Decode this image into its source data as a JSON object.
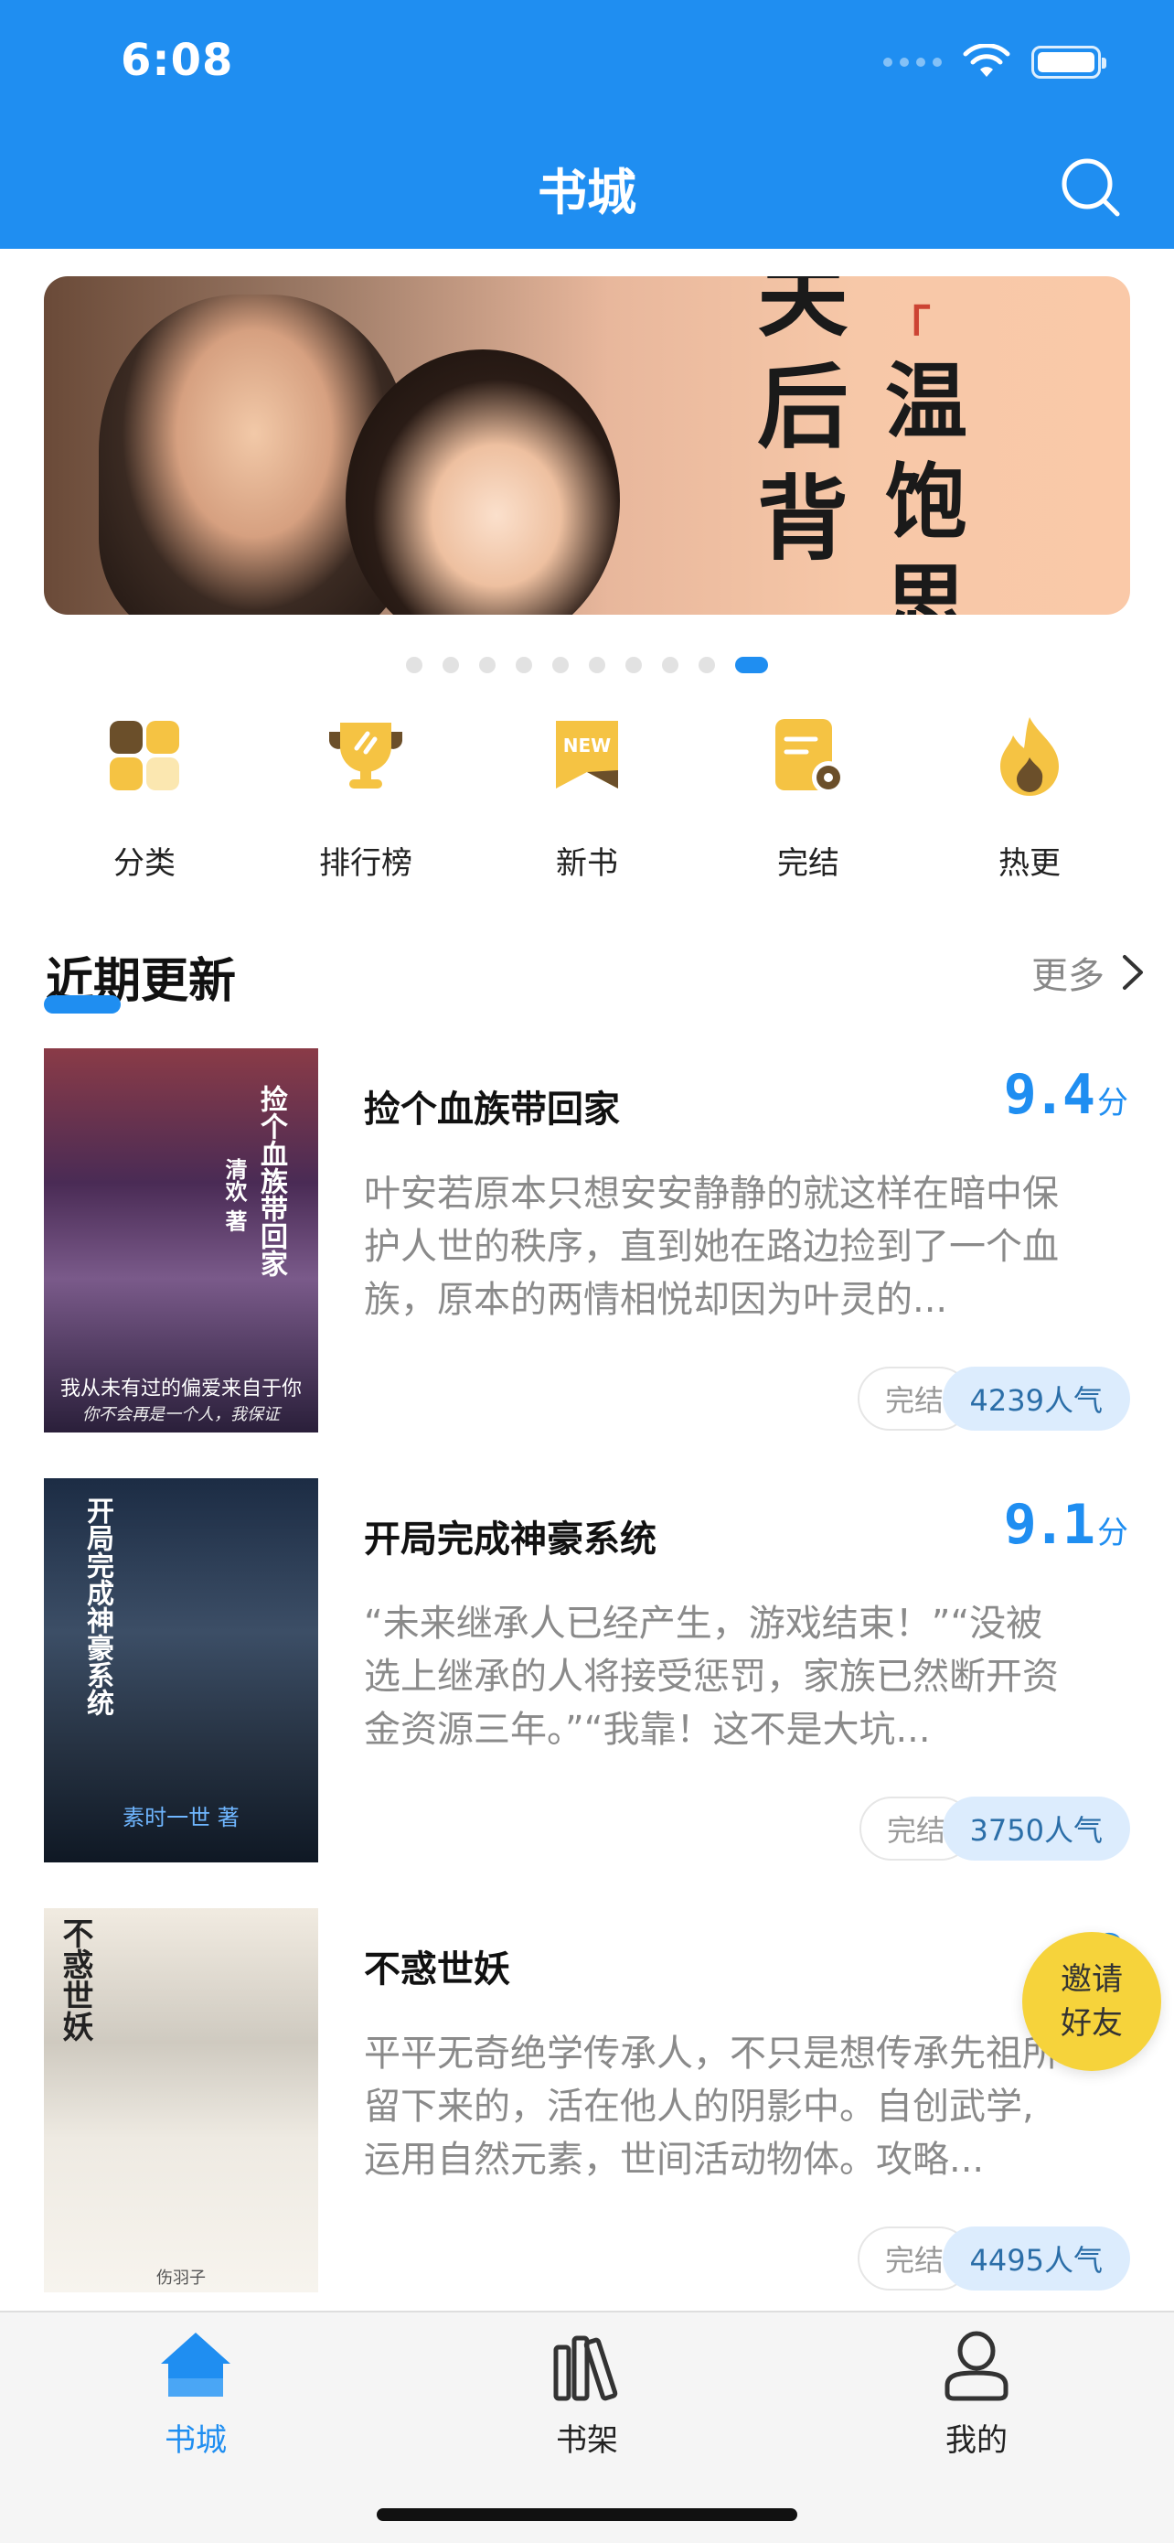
{
  "status_bar": {
    "time": "6:08"
  },
  "header": {
    "title": "书城",
    "search_icon": "search-icon"
  },
  "banner": {
    "text_col1": [
      "关",
      "后",
      "背"
    ],
    "text_col2": [
      "「",
      "温",
      "饱",
      "思"
    ],
    "dots_total": 10,
    "active_dot": 10
  },
  "categories": [
    {
      "label": "分类",
      "icon": "grid-category-icon"
    },
    {
      "label": "排行榜",
      "icon": "trophy-icon"
    },
    {
      "label": "新书",
      "icon": "new-badge-icon",
      "badge": "NEW"
    },
    {
      "label": "完结",
      "icon": "finished-doc-icon"
    },
    {
      "label": "热更",
      "icon": "flame-icon"
    }
  ],
  "section": {
    "title": "近期更新",
    "more": "更多"
  },
  "books": [
    {
      "title": "捡个血族带回家",
      "score": "9.4",
      "score_unit": "分",
      "desc": "叶安若原本只想安安静静的就这样在暗中保护人世的秩序，直到她在路边捡到了一个血族，原本的两情相悦却因为叶灵的...",
      "status": "完结",
      "popularity": "4239人气",
      "cover_title": "捡个血族带回家",
      "cover_author": "清欢 著",
      "cover_tagline": "我从未有过的偏爱来自于你",
      "cover_tagline2": "你不会再是一个人，我保证"
    },
    {
      "title": "开局完成神豪系统",
      "score": "9.1",
      "score_unit": "分",
      "desc": "“未来继承人已经产生，游戏结束！”“没被选上继承的人将接受惩罚，家族已然断开资金资源三年。”“我靠！这不是大坑...",
      "status": "完结",
      "popularity": "3750人气",
      "cover_title": "开局完成神豪系统",
      "cover_author": "素时一世 著"
    },
    {
      "title": "不惑世妖",
      "score": "9",
      "score_unit": "",
      "desc": "平平无奇绝学传承人，不只是想传承先祖所留下来的，活在他人的阴影中。自创武学,运用自然元素，世间活动物体。攻略...",
      "status": "完结",
      "popularity": "4495人气",
      "cover_title": "不惑世妖",
      "cover_author": "伤羽子"
    }
  ],
  "invite": {
    "line1": "邀请",
    "line2": "好友"
  },
  "tabbar": [
    {
      "label": "书城",
      "icon": "home-icon",
      "active": true
    },
    {
      "label": "书架",
      "icon": "bookshelf-icon",
      "active": false
    },
    {
      "label": "我的",
      "icon": "profile-icon",
      "active": false
    }
  ],
  "colors": {
    "primary": "#1f8ef1",
    "icon_yellow": "#f5c343",
    "invite_yellow": "#f6d33b"
  }
}
